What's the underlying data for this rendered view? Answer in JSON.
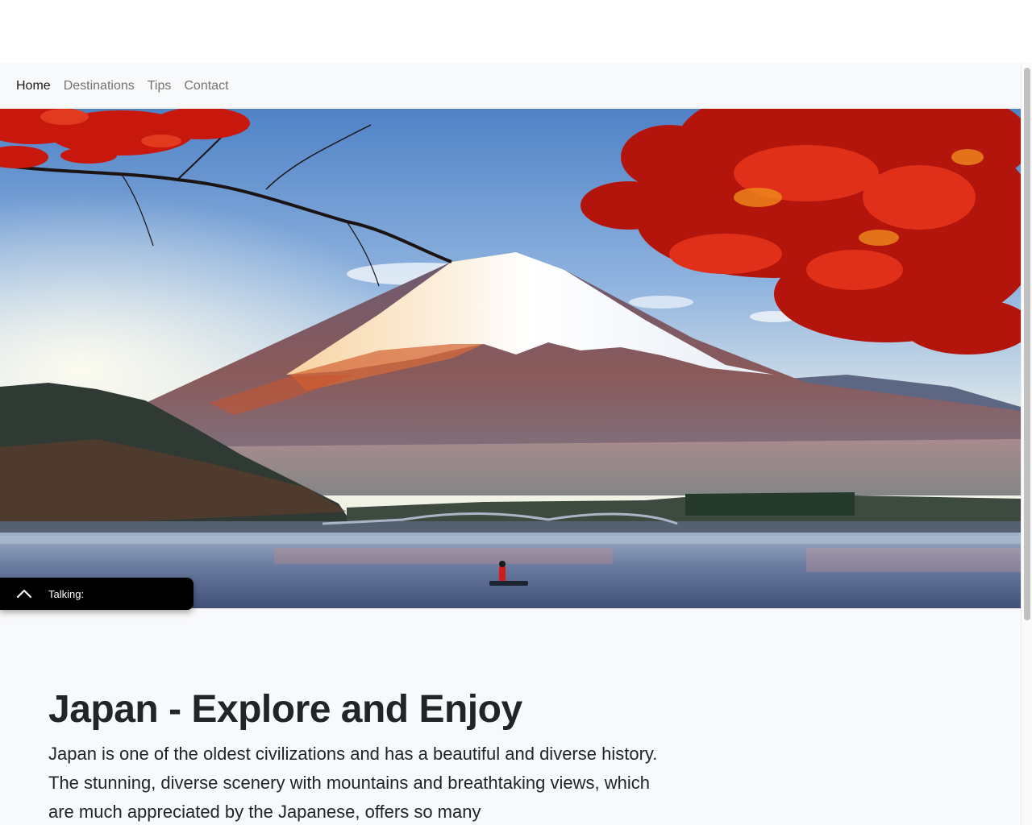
{
  "nav": {
    "items": [
      {
        "label": "Home",
        "active": true
      },
      {
        "label": "Destinations"
      },
      {
        "label": "Tips"
      },
      {
        "label": "Contact"
      }
    ]
  },
  "hero": {
    "image": "mount-fuji-autumn-lake-landscape"
  },
  "talk_widget": {
    "label": "Talking:",
    "icon": "chevron-up-icon"
  },
  "main": {
    "title": "Japan - Explore and Enjoy",
    "intro": "Japan is one of the oldest civilizations and has a beautiful and diverse history. The stunning, diverse scenery with mountains and breathtaking views, which are much appreciated by the Japanese, offers so many"
  },
  "colors": {
    "page_bg": "#f8f9fa",
    "widget_bg": "#000000",
    "leaf_red": "#c8180e"
  }
}
